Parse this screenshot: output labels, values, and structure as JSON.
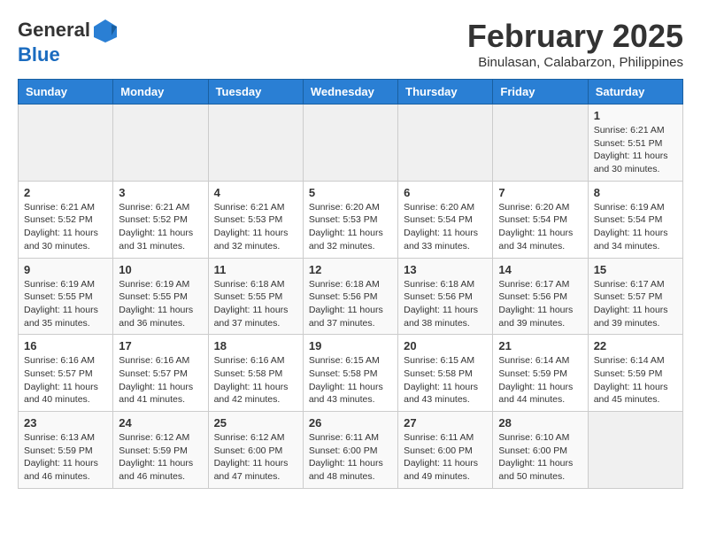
{
  "header": {
    "logo_line1": "General",
    "logo_line2": "Blue",
    "month_year": "February 2025",
    "location": "Binulasan, Calabarzon, Philippines"
  },
  "weekdays": [
    "Sunday",
    "Monday",
    "Tuesday",
    "Wednesday",
    "Thursday",
    "Friday",
    "Saturday"
  ],
  "weeks": [
    [
      {
        "day": "",
        "info": ""
      },
      {
        "day": "",
        "info": ""
      },
      {
        "day": "",
        "info": ""
      },
      {
        "day": "",
        "info": ""
      },
      {
        "day": "",
        "info": ""
      },
      {
        "day": "",
        "info": ""
      },
      {
        "day": "1",
        "info": "Sunrise: 6:21 AM\nSunset: 5:51 PM\nDaylight: 11 hours\nand 30 minutes."
      }
    ],
    [
      {
        "day": "2",
        "info": "Sunrise: 6:21 AM\nSunset: 5:52 PM\nDaylight: 11 hours\nand 30 minutes."
      },
      {
        "day": "3",
        "info": "Sunrise: 6:21 AM\nSunset: 5:52 PM\nDaylight: 11 hours\nand 31 minutes."
      },
      {
        "day": "4",
        "info": "Sunrise: 6:21 AM\nSunset: 5:53 PM\nDaylight: 11 hours\nand 32 minutes."
      },
      {
        "day": "5",
        "info": "Sunrise: 6:20 AM\nSunset: 5:53 PM\nDaylight: 11 hours\nand 32 minutes."
      },
      {
        "day": "6",
        "info": "Sunrise: 6:20 AM\nSunset: 5:54 PM\nDaylight: 11 hours\nand 33 minutes."
      },
      {
        "day": "7",
        "info": "Sunrise: 6:20 AM\nSunset: 5:54 PM\nDaylight: 11 hours\nand 34 minutes."
      },
      {
        "day": "8",
        "info": "Sunrise: 6:19 AM\nSunset: 5:54 PM\nDaylight: 11 hours\nand 34 minutes."
      }
    ],
    [
      {
        "day": "9",
        "info": "Sunrise: 6:19 AM\nSunset: 5:55 PM\nDaylight: 11 hours\nand 35 minutes."
      },
      {
        "day": "10",
        "info": "Sunrise: 6:19 AM\nSunset: 5:55 PM\nDaylight: 11 hours\nand 36 minutes."
      },
      {
        "day": "11",
        "info": "Sunrise: 6:18 AM\nSunset: 5:55 PM\nDaylight: 11 hours\nand 37 minutes."
      },
      {
        "day": "12",
        "info": "Sunrise: 6:18 AM\nSunset: 5:56 PM\nDaylight: 11 hours\nand 37 minutes."
      },
      {
        "day": "13",
        "info": "Sunrise: 6:18 AM\nSunset: 5:56 PM\nDaylight: 11 hours\nand 38 minutes."
      },
      {
        "day": "14",
        "info": "Sunrise: 6:17 AM\nSunset: 5:56 PM\nDaylight: 11 hours\nand 39 minutes."
      },
      {
        "day": "15",
        "info": "Sunrise: 6:17 AM\nSunset: 5:57 PM\nDaylight: 11 hours\nand 39 minutes."
      }
    ],
    [
      {
        "day": "16",
        "info": "Sunrise: 6:16 AM\nSunset: 5:57 PM\nDaylight: 11 hours\nand 40 minutes."
      },
      {
        "day": "17",
        "info": "Sunrise: 6:16 AM\nSunset: 5:57 PM\nDaylight: 11 hours\nand 41 minutes."
      },
      {
        "day": "18",
        "info": "Sunrise: 6:16 AM\nSunset: 5:58 PM\nDaylight: 11 hours\nand 42 minutes."
      },
      {
        "day": "19",
        "info": "Sunrise: 6:15 AM\nSunset: 5:58 PM\nDaylight: 11 hours\nand 43 minutes."
      },
      {
        "day": "20",
        "info": "Sunrise: 6:15 AM\nSunset: 5:58 PM\nDaylight: 11 hours\nand 43 minutes."
      },
      {
        "day": "21",
        "info": "Sunrise: 6:14 AM\nSunset: 5:59 PM\nDaylight: 11 hours\nand 44 minutes."
      },
      {
        "day": "22",
        "info": "Sunrise: 6:14 AM\nSunset: 5:59 PM\nDaylight: 11 hours\nand 45 minutes."
      }
    ],
    [
      {
        "day": "23",
        "info": "Sunrise: 6:13 AM\nSunset: 5:59 PM\nDaylight: 11 hours\nand 46 minutes."
      },
      {
        "day": "24",
        "info": "Sunrise: 6:12 AM\nSunset: 5:59 PM\nDaylight: 11 hours\nand 46 minutes."
      },
      {
        "day": "25",
        "info": "Sunrise: 6:12 AM\nSunset: 6:00 PM\nDaylight: 11 hours\nand 47 minutes."
      },
      {
        "day": "26",
        "info": "Sunrise: 6:11 AM\nSunset: 6:00 PM\nDaylight: 11 hours\nand 48 minutes."
      },
      {
        "day": "27",
        "info": "Sunrise: 6:11 AM\nSunset: 6:00 PM\nDaylight: 11 hours\nand 49 minutes."
      },
      {
        "day": "28",
        "info": "Sunrise: 6:10 AM\nSunset: 6:00 PM\nDaylight: 11 hours\nand 50 minutes."
      },
      {
        "day": "",
        "info": ""
      }
    ]
  ]
}
